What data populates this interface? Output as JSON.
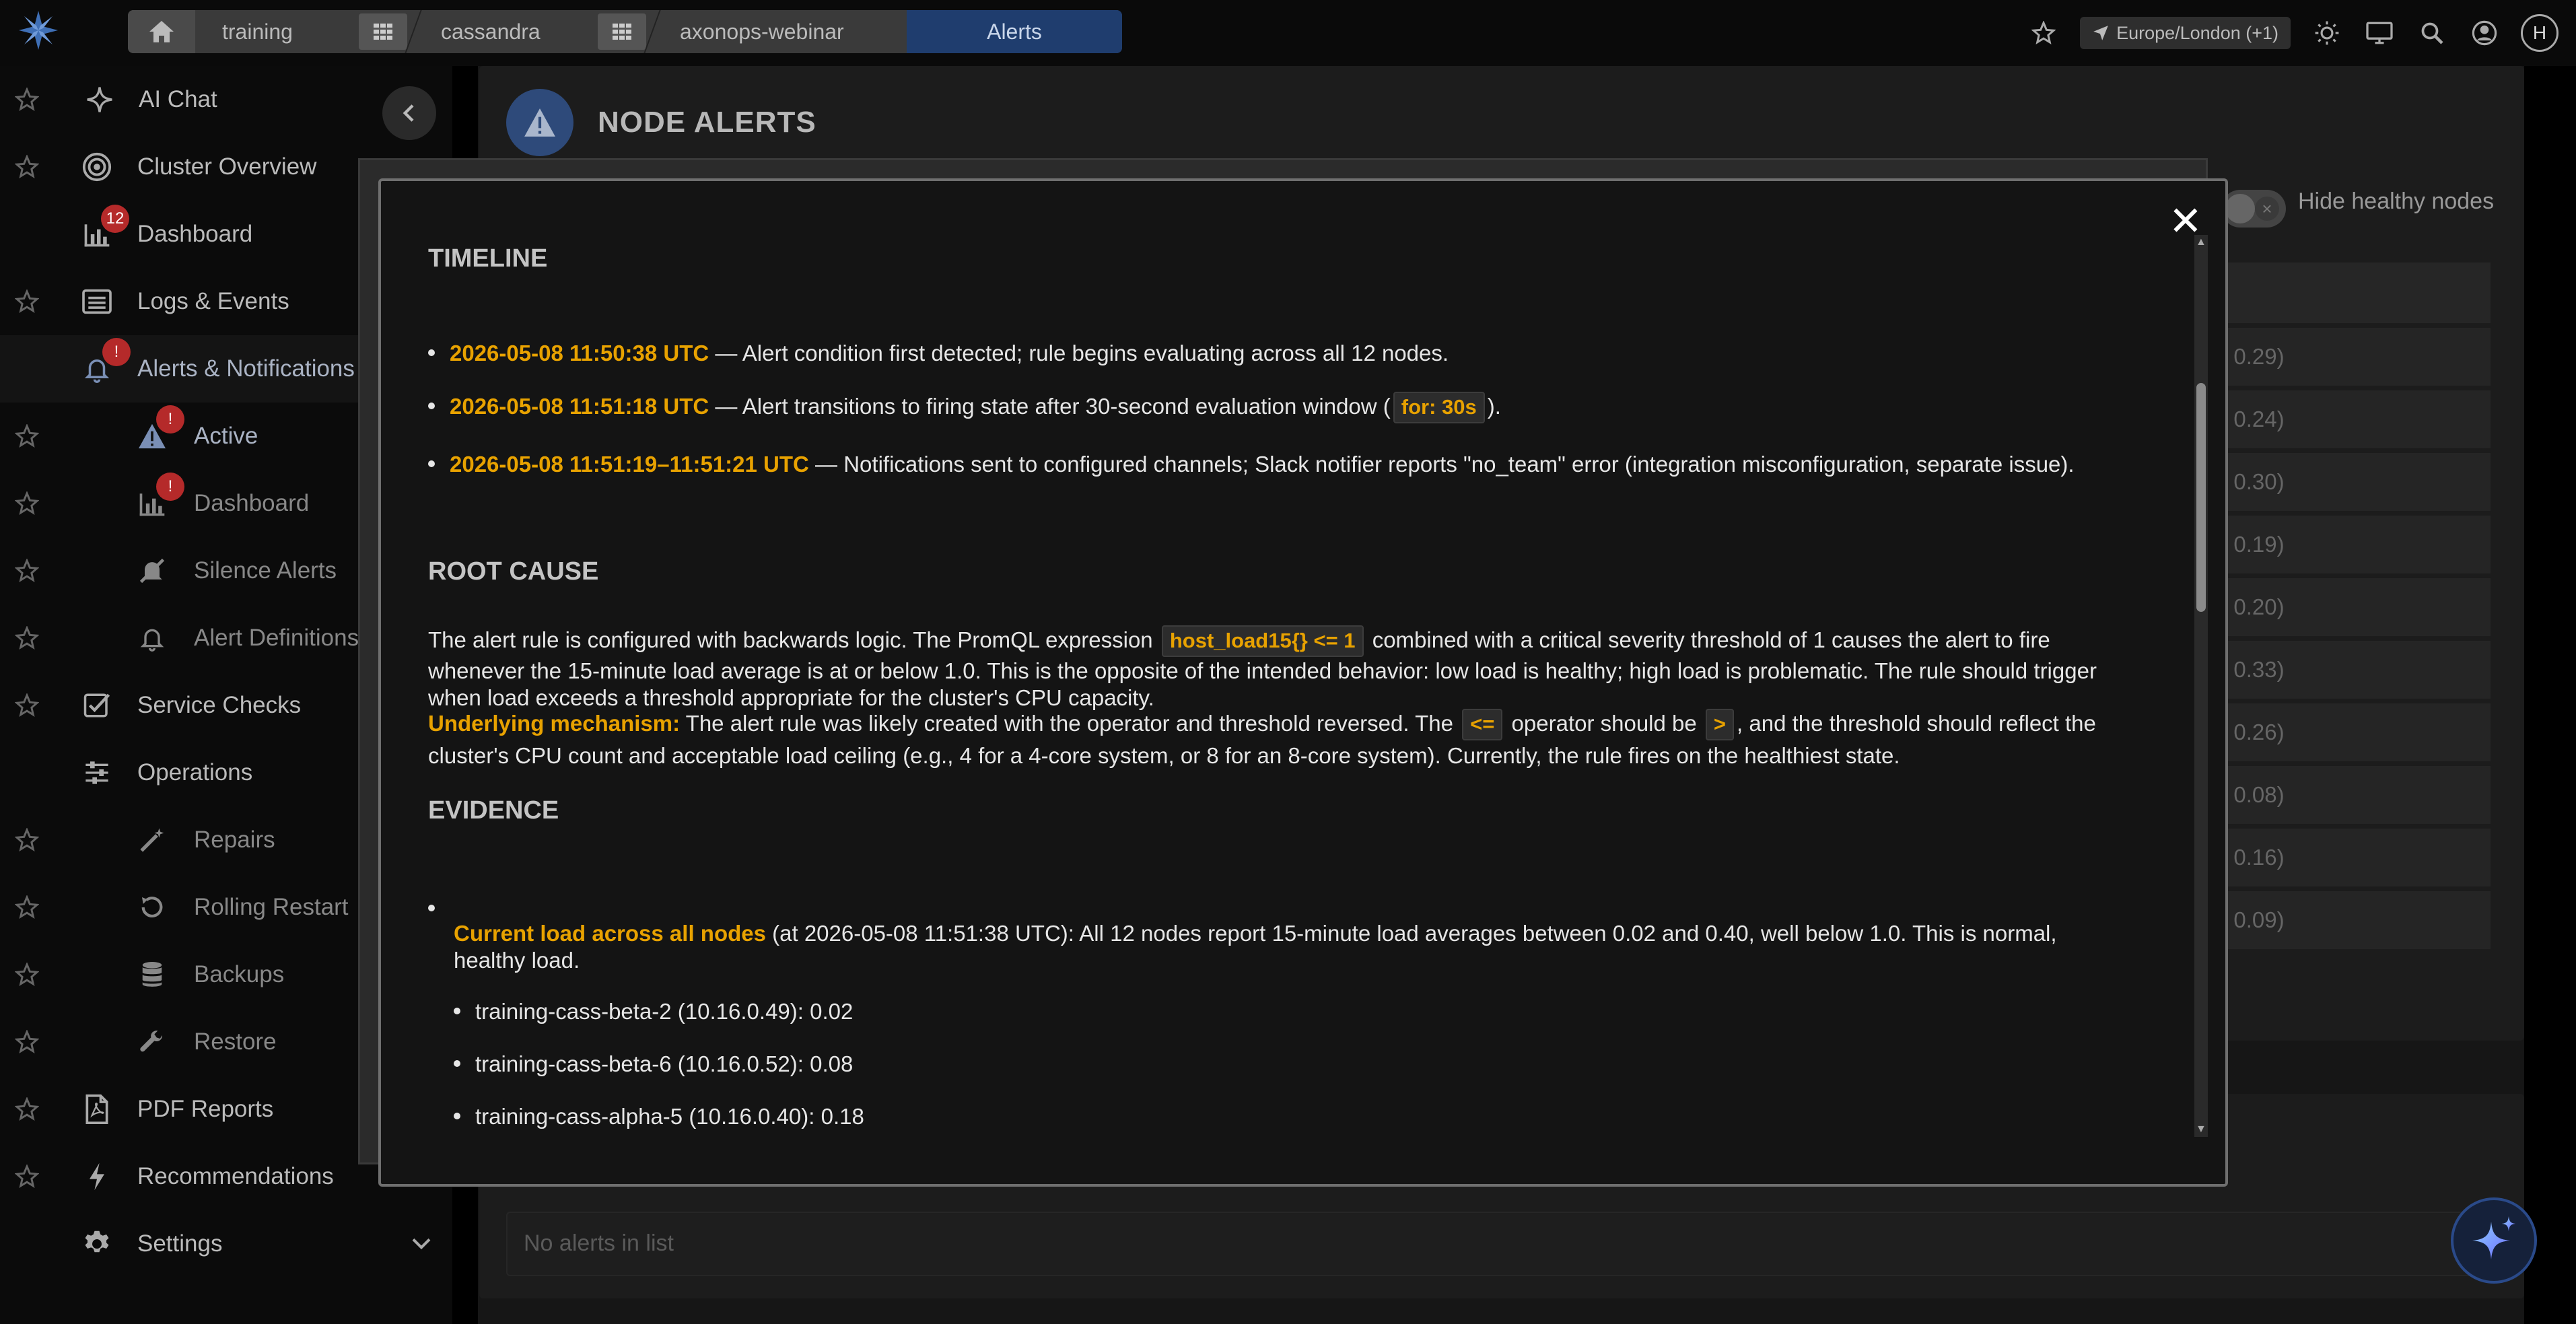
{
  "breadcrumb": {
    "items": [
      "training",
      "cassandra",
      "axonops-webinar",
      "Alerts"
    ]
  },
  "topbar": {
    "timezone": "Europe/London (+1)",
    "avatar_initial": "H"
  },
  "sidebar": {
    "items": [
      {
        "label": "AI Chat"
      },
      {
        "label": "Cluster Overview"
      },
      {
        "label": "Dashboard",
        "badge": "12"
      },
      {
        "label": "Logs & Events"
      },
      {
        "label": "Alerts & Notifications",
        "badge": "!"
      },
      {
        "label": "Active",
        "badge": "!"
      },
      {
        "label": "Dashboard",
        "badge": "!"
      },
      {
        "label": "Silence Alerts"
      },
      {
        "label": "Alert Definitions"
      },
      {
        "label": "Service Checks"
      },
      {
        "label": "Operations"
      },
      {
        "label": "Repairs"
      },
      {
        "label": "Rolling Restart"
      },
      {
        "label": "Backups"
      },
      {
        "label": "Restore"
      },
      {
        "label": "PDF Reports"
      },
      {
        "label": "Recommendations"
      },
      {
        "label": "Settings"
      }
    ]
  },
  "page": {
    "title": "NODE ALERTS",
    "hide_healthy_label": "Hide healthy nodes",
    "bg_rows": [
      ": 0.29)",
      ": 0.24)",
      ": 0.30)",
      ": 0.19)",
      ": 0.20)",
      ": 0.33)",
      ": 0.26)",
      ": 0.08)",
      ": 0.16)",
      ": 0.09)"
    ],
    "no_alerts": "No alerts in list"
  },
  "modal": {
    "close": "✕",
    "timeline_heading": "TIMELINE",
    "timeline": [
      {
        "ts": "2026-05-08 11:50:38 UTC",
        "text": " — Alert condition first detected; rule begins evaluating across all 12 nodes."
      },
      {
        "ts": "2026-05-08 11:51:18 UTC",
        "text_a": " — Alert transitions to firing state after 30-second evaluation window (",
        "code": "for: 30s",
        "text_b": ")."
      },
      {
        "ts": "2026-05-08 11:51:19–11:51:21 UTC",
        "text": " — Notifications sent to configured channels; Slack notifier reports \"no_team\" error (integration misconfiguration, separate issue)."
      }
    ],
    "root_cause_heading": "ROOT CAUSE",
    "root_cause": {
      "p1_a": "The alert rule is configured with backwards logic. The PromQL expression",
      "p1_code": "host_load15{} <= 1",
      "p1_b": "combined with a critical severity threshold of 1 causes the alert to fire",
      "p1_line2": "whenever the 15-minute load average is at or below 1.0. This is the opposite of the intended behavior: low load is healthy; high load is problematic. The rule should trigger",
      "p1_line3": "when load exceeds a threshold appropriate for the cluster's CPU capacity.",
      "mech_label": "Underlying mechanism:",
      "mech_a": " The alert rule was likely created with the operator and threshold reversed. The ",
      "mech_code1": "<=",
      "mech_b": " operator should be ",
      "mech_code2": ">",
      "mech_c": ", and the threshold should reflect the",
      "mech_line2": "cluster's CPU count and acceptable load ceiling (e.g., 4 for a 4-core system, or 8 for an 8-core system). Currently, the rule fires on the healthiest state."
    },
    "evidence_heading": "EVIDENCE",
    "evidence": {
      "label": "Current load across all nodes",
      "text_line1": " (at 2026-05-08 11:51:38 UTC): All 12 nodes report 15-minute load averages between 0.02 and 0.40, well below 1.0. This is normal,",
      "text_line2": "healthy load.",
      "nodes": [
        "training-cass-beta-2 (10.16.0.49): 0.02",
        "training-cass-beta-6 (10.16.0.52): 0.08",
        "training-cass-alpha-5 (10.16.0.40): 0.18"
      ]
    }
  }
}
